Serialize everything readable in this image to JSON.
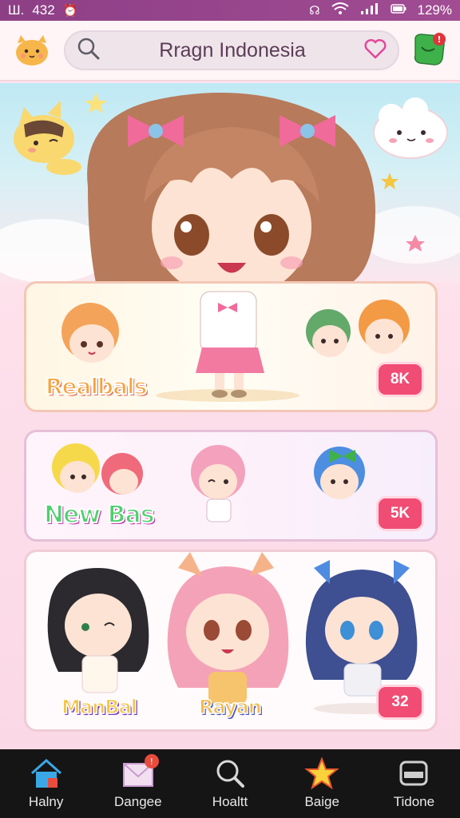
{
  "status_bar": {
    "time": "432",
    "left_glyph": "Ш.",
    "battery": "129%",
    "icons": [
      "alarm-icon",
      "vibrate-icon",
      "wifi-icon",
      "signal-icon",
      "battery-icon"
    ]
  },
  "header": {
    "search_text": "Rragn Indonesia",
    "icons": [
      "mascot-icon",
      "search-icon",
      "heart-icon",
      "notification-icon"
    ]
  },
  "cards": [
    {
      "title": "Realbals",
      "count": "8K"
    },
    {
      "title": "New Bas",
      "count": "5K"
    },
    {
      "title_left": "ManBal",
      "title_center": "Rayan",
      "count": "32"
    }
  ],
  "bottom_nav": {
    "items": [
      {
        "label": "Halny",
        "icon": "home-icon"
      },
      {
        "label": "Dangee",
        "icon": "mail-icon",
        "badge": "!"
      },
      {
        "label": "Hoaltt",
        "icon": "search-icon"
      },
      {
        "label": "Baige",
        "icon": "star-icon"
      },
      {
        "label": "Tidone",
        "icon": "profile-icon"
      }
    ]
  },
  "colors": {
    "status_bar": "#8d3f86",
    "accent": "#f04c74",
    "nav_bg": "#151515"
  }
}
